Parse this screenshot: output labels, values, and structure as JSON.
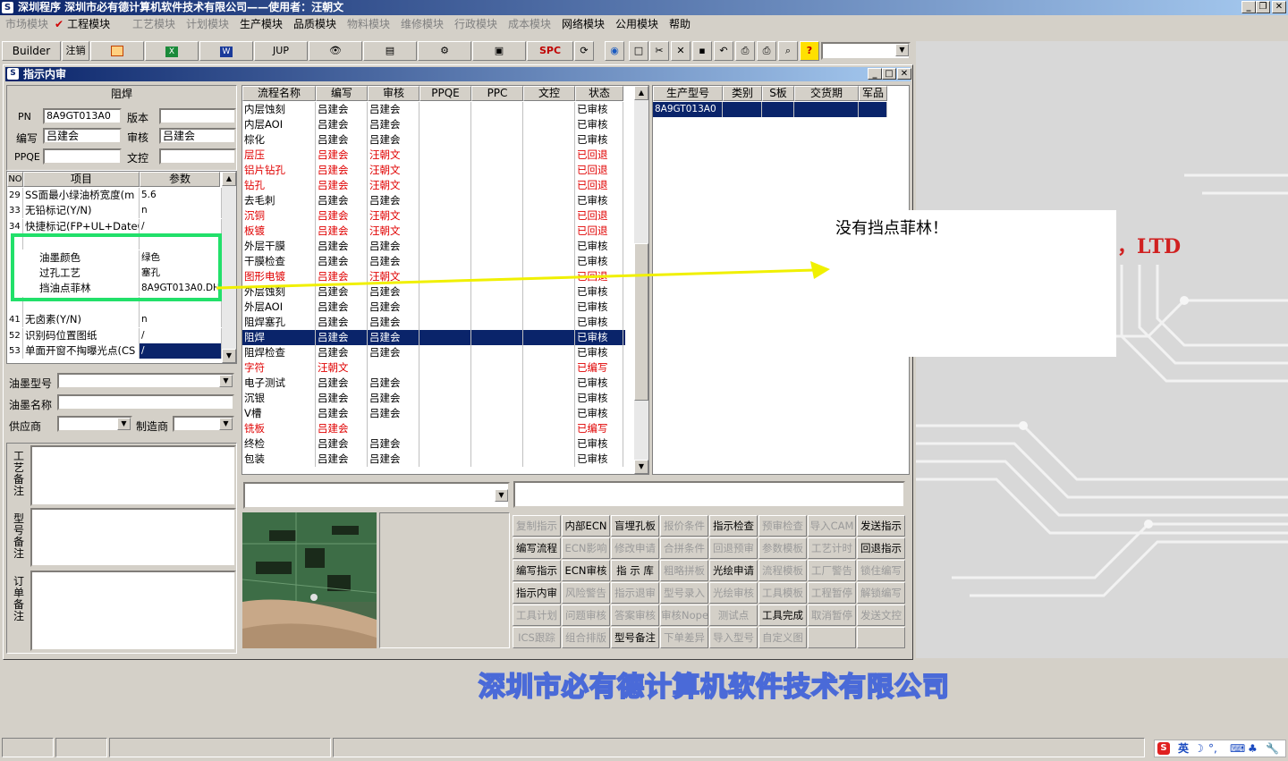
{
  "app": {
    "title": "深圳程序    深圳市必有德计算机软件技术有限公司——使用者：汪朝文",
    "icon": "app-icon"
  },
  "menu": {
    "items": [
      {
        "label": "市场模块",
        "disabled": true
      },
      {
        "label": "工程模块",
        "disabled": false,
        "checked": true
      },
      {
        "label": "工艺模块",
        "disabled": true
      },
      {
        "label": "计划模块",
        "disabled": true
      },
      {
        "label": "生产模块",
        "disabled": false
      },
      {
        "label": "品质模块",
        "disabled": false
      },
      {
        "label": "物料模块",
        "disabled": true
      },
      {
        "label": "维修模块",
        "disabled": true
      },
      {
        "label": "行政模块",
        "disabled": true
      },
      {
        "label": "成本模块",
        "disabled": true
      },
      {
        "label": "网络模块",
        "disabled": false
      },
      {
        "label": "公用模块",
        "disabled": false
      },
      {
        "label": "帮助",
        "disabled": false
      }
    ]
  },
  "toolbar": {
    "builder": "Builder",
    "logout": "注销",
    "jup": "JUP",
    "spc": "SPC"
  },
  "window": {
    "title": "指示内审"
  },
  "left": {
    "section": "阻焊",
    "pn_label": "PN",
    "pn_value": "8A9GT013A0",
    "version_label": "版本",
    "version_value": "",
    "author_label": "编写",
    "author_value": "吕建会",
    "review_label": "审核",
    "review_value": "吕建会",
    "ppqe_label": "PPQE",
    "ppqe_value": "",
    "dc_label": "文控",
    "dc_value": "",
    "param_headers": [
      "NO",
      "项目",
      "参数"
    ],
    "params": [
      {
        "no": "29",
        "item": "SS面最小绿油桥宽度(m",
        "val": "5.6"
      },
      {
        "no": "33",
        "item": "无铅标记(Y/N)",
        "val": "n"
      },
      {
        "no": "34",
        "item": "快捷标记(FP+UL+DateCo",
        "val": "/"
      },
      {
        "no": "",
        "item": "",
        "val": ""
      },
      {
        "no": "",
        "item": "油墨颜色",
        "val": "绿色"
      },
      {
        "no": "",
        "item": "过孔工艺",
        "val": "塞孔"
      },
      {
        "no": "",
        "item": "挡油点菲林",
        "val": "8A9GT013A0.DH"
      },
      {
        "no": "",
        "item": "",
        "val": ""
      },
      {
        "no": "41",
        "item": "无卤素(Y/N)",
        "val": "n"
      },
      {
        "no": "52",
        "item": "识别码位置图纸",
        "val": "/"
      },
      {
        "no": "53",
        "item": "单面开窗不掏曝光点(CS",
        "val": "/"
      }
    ],
    "ink_type_label": "油墨型号",
    "ink_name_label": "油墨名称",
    "supplier_label": "供应商",
    "maker_label": "制造商",
    "craft_note_label": "工艺备注",
    "model_note_label": "型号备注",
    "order_note_label": "订单备注"
  },
  "flow": {
    "headers": [
      "流程名称",
      "编写",
      "审核",
      "PPQE",
      "PPC",
      "文控",
      "状态"
    ],
    "rows": [
      {
        "name": "内层蚀刻",
        "author": "吕建会",
        "reviewer": "吕建会",
        "status": "已审核",
        "red": false
      },
      {
        "name": "内层AOI",
        "author": "吕建会",
        "reviewer": "吕建会",
        "status": "已审核",
        "red": false
      },
      {
        "name": "棕化",
        "author": "吕建会",
        "reviewer": "吕建会",
        "status": "已审核",
        "red": false
      },
      {
        "name": "层压",
        "author": "吕建会",
        "reviewer": "汪朝文",
        "status": "已回退",
        "red": true
      },
      {
        "name": "铝片钻孔",
        "author": "吕建会",
        "reviewer": "汪朝文",
        "status": "已回退",
        "red": true
      },
      {
        "name": "钻孔",
        "author": "吕建会",
        "reviewer": "汪朝文",
        "status": "已回退",
        "red": true
      },
      {
        "name": "去毛刺",
        "author": "吕建会",
        "reviewer": "吕建会",
        "status": "已审核",
        "red": false
      },
      {
        "name": "沉铜",
        "author": "吕建会",
        "reviewer": "汪朝文",
        "status": "已回退",
        "red": true
      },
      {
        "name": "板镀",
        "author": "吕建会",
        "reviewer": "汪朝文",
        "status": "已回退",
        "red": true
      },
      {
        "name": "外层干膜",
        "author": "吕建会",
        "reviewer": "吕建会",
        "status": "已审核",
        "red": false
      },
      {
        "name": "干膜检查",
        "author": "吕建会",
        "reviewer": "吕建会",
        "status": "已审核",
        "red": false
      },
      {
        "name": "图形电镀",
        "author": "吕建会",
        "reviewer": "汪朝文",
        "status": "已回退",
        "red": true
      },
      {
        "name": "外层蚀刻",
        "author": "吕建会",
        "reviewer": "吕建会",
        "status": "已审核",
        "red": false
      },
      {
        "name": "外层AOI",
        "author": "吕建会",
        "reviewer": "吕建会",
        "status": "已审核",
        "red": false
      },
      {
        "name": "阻焊塞孔",
        "author": "吕建会",
        "reviewer": "吕建会",
        "status": "已审核",
        "red": false
      },
      {
        "name": "阻焊",
        "author": "吕建会",
        "reviewer": "吕建会",
        "status": "已审核",
        "red": false,
        "selected": true
      },
      {
        "name": "阻焊检查",
        "author": "吕建会",
        "reviewer": "吕建会",
        "status": "已审核",
        "red": false
      },
      {
        "name": "字符",
        "author": "汪朝文",
        "reviewer": "",
        "status": "已编写",
        "red": true
      },
      {
        "name": "电子测试",
        "author": "吕建会",
        "reviewer": "吕建会",
        "status": "已审核",
        "red": false
      },
      {
        "name": "沉银",
        "author": "吕建会",
        "reviewer": "吕建会",
        "status": "已审核",
        "red": false
      },
      {
        "name": "V槽",
        "author": "吕建会",
        "reviewer": "吕建会",
        "status": "已审核",
        "red": false
      },
      {
        "name": "铣板",
        "author": "吕建会",
        "reviewer": "",
        "status": "已编写",
        "red": true
      },
      {
        "name": "终检",
        "author": "吕建会",
        "reviewer": "吕建会",
        "status": "已审核",
        "red": false
      },
      {
        "name": "包装",
        "author": "吕建会",
        "reviewer": "吕建会",
        "status": "已审核",
        "red": false
      }
    ]
  },
  "production": {
    "headers": [
      "生产型号",
      "类别",
      "S板",
      "交货期",
      "军品"
    ],
    "rows": [
      {
        "model": "8A9GT013A0",
        "type": "",
        "s": "",
        "due": "",
        "mil": ""
      }
    ]
  },
  "actions": [
    [
      {
        "l": "复制指示",
        "on": false
      },
      {
        "l": "内部ECN",
        "on": true
      },
      {
        "l": "盲埋孔板",
        "on": true
      },
      {
        "l": "报价条件",
        "on": false
      },
      {
        "l": "指示检查",
        "on": true
      },
      {
        "l": "预审检查",
        "on": false
      },
      {
        "l": "导入CAM",
        "on": false
      },
      {
        "l": "发送指示",
        "on": true
      }
    ],
    [
      {
        "l": "编写流程",
        "on": true
      },
      {
        "l": "ECN影响",
        "on": false
      },
      {
        "l": "修改申请",
        "on": false
      },
      {
        "l": "合拼条件",
        "on": false
      },
      {
        "l": "回退预审",
        "on": false
      },
      {
        "l": "参数模板",
        "on": false
      },
      {
        "l": "工艺计时",
        "on": false
      },
      {
        "l": "回退指示",
        "on": true
      }
    ],
    [
      {
        "l": "编写指示",
        "on": true
      },
      {
        "l": "ECN审核",
        "on": true
      },
      {
        "l": "指 示 库",
        "on": true
      },
      {
        "l": "粗略拼板",
        "on": false
      },
      {
        "l": "光绘申请",
        "on": true
      },
      {
        "l": "流程模板",
        "on": false
      },
      {
        "l": "工厂警告",
        "on": false
      },
      {
        "l": "锁住编写",
        "on": false
      }
    ],
    [
      {
        "l": "指示内审",
        "on": true
      },
      {
        "l": "风险警告",
        "on": false
      },
      {
        "l": "指示退审",
        "on": false
      },
      {
        "l": "型号录入",
        "on": false
      },
      {
        "l": "光绘审核",
        "on": false
      },
      {
        "l": "工具模板",
        "on": false
      },
      {
        "l": "工程暂停",
        "on": false
      },
      {
        "l": "解锁编写",
        "on": false
      }
    ],
    [
      {
        "l": "工具计划",
        "on": false
      },
      {
        "l": "问题审核",
        "on": false
      },
      {
        "l": "答案审核",
        "on": false
      },
      {
        "l": "审核Nope",
        "on": false
      },
      {
        "l": "测试点",
        "on": false
      },
      {
        "l": "工具完成",
        "on": true
      },
      {
        "l": "取消暂停",
        "on": false
      },
      {
        "l": "发送文控",
        "on": false
      }
    ],
    [
      {
        "l": "ICS跟踪",
        "on": false
      },
      {
        "l": "组合排版",
        "on": false
      },
      {
        "l": "型号备注",
        "on": true
      },
      {
        "l": "下单差异",
        "on": false
      },
      {
        "l": "导入型号",
        "on": false
      },
      {
        "l": "自定义图",
        "on": false
      },
      {
        "l": "",
        "on": false
      },
      {
        "l": "",
        "on": false
      }
    ]
  ],
  "callout": {
    "text": "没有挡点菲林！"
  },
  "background": {
    "company": "深圳市必有德计算机软件技术有限公司",
    "ltd": "，LTD"
  },
  "tray": {
    "ime": "英"
  },
  "colors": {
    "highlight": "#22e06a",
    "arrow": "#f0f000",
    "accent": "#0a246a",
    "red": "#e00000"
  }
}
